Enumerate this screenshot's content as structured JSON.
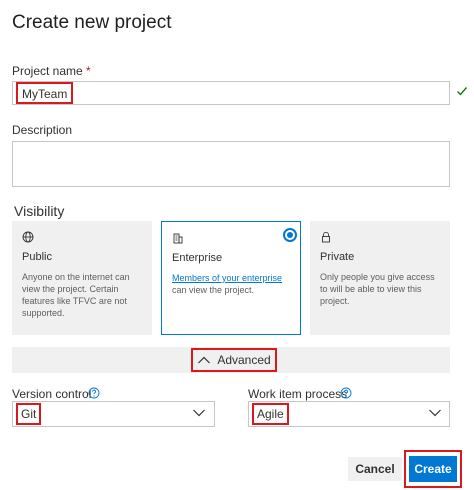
{
  "dialog": {
    "title": "Create new project"
  },
  "project_name": {
    "label": "Project name",
    "required_mark": "*",
    "value": "MyTeam"
  },
  "description": {
    "label": "Description",
    "value": ""
  },
  "visibility": {
    "heading": "Visibility",
    "options": [
      {
        "icon": "globe-icon",
        "title": "Public",
        "description": "Anyone on the internet can view the project. Certain features like TFVC are not supported."
      },
      {
        "icon": "enterprise-icon",
        "title": "Enterprise",
        "link_text": "Members of your enterprise",
        "description_after_link": " can view the project.",
        "selected": true
      },
      {
        "icon": "lock-icon",
        "title": "Private",
        "description": "Only people you give access to will be able to view this project."
      }
    ]
  },
  "advanced": {
    "label": "Advanced"
  },
  "version_control": {
    "label": "Version control",
    "value": "Git"
  },
  "work_item_process": {
    "label": "Work item process",
    "value": "Agile"
  },
  "actions": {
    "cancel_label": "Cancel",
    "create_label": "Create"
  },
  "colors": {
    "accent": "#0078d4",
    "highlight": "#d71920",
    "success": "#107c10"
  }
}
